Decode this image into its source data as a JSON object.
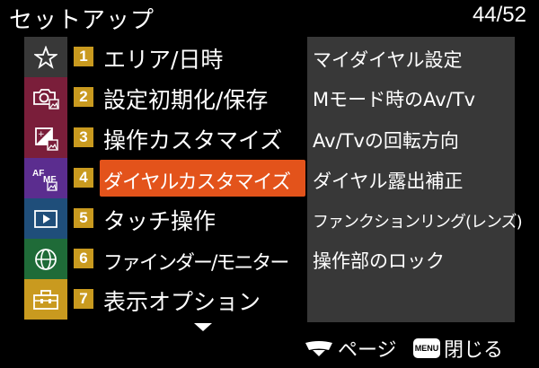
{
  "header": {
    "title": "セットアップ",
    "counter": "44/52"
  },
  "sidebar": {
    "tabs": [
      {
        "icon": "star-icon",
        "color": "#383838"
      },
      {
        "icon": "camera-photo-icon",
        "color": "#7a1e3a"
      },
      {
        "icon": "exposure-icon",
        "color": "#7a1e3a"
      },
      {
        "icon": "af-mf-icon",
        "color": "#5b2d8f"
      },
      {
        "icon": "playback-icon",
        "color": "#1f4e7a"
      },
      {
        "icon": "globe-network-icon",
        "color": "#1f6b38"
      },
      {
        "icon": "toolbox-setup-icon",
        "color": "#c99a1f"
      }
    ]
  },
  "menu": {
    "selected_index": 3,
    "highlight_color": "#e3531b",
    "items": [
      {
        "number": "1",
        "label": "エリア/日時"
      },
      {
        "number": "2",
        "label": "設定初期化/保存"
      },
      {
        "number": "3",
        "label": "操作カスタマイズ"
      },
      {
        "number": "4",
        "label": "ダイヤルカスタマイズ"
      },
      {
        "number": "5",
        "label": "タッチ操作"
      },
      {
        "number": "6",
        "label": "ファインダー/モニター"
      },
      {
        "number": "7",
        "label": "表示オプション"
      }
    ]
  },
  "submenu": {
    "items": [
      "マイダイヤル設定",
      "Mモード時のAv/Tv",
      "Av/Tvの回転方向",
      "ダイヤル露出補正",
      "ファンクションリング(レンズ)",
      "操作部のロック"
    ]
  },
  "footer": {
    "page_hint": "ページ",
    "menu_key": "MENU",
    "close_hint": "閉じる"
  }
}
